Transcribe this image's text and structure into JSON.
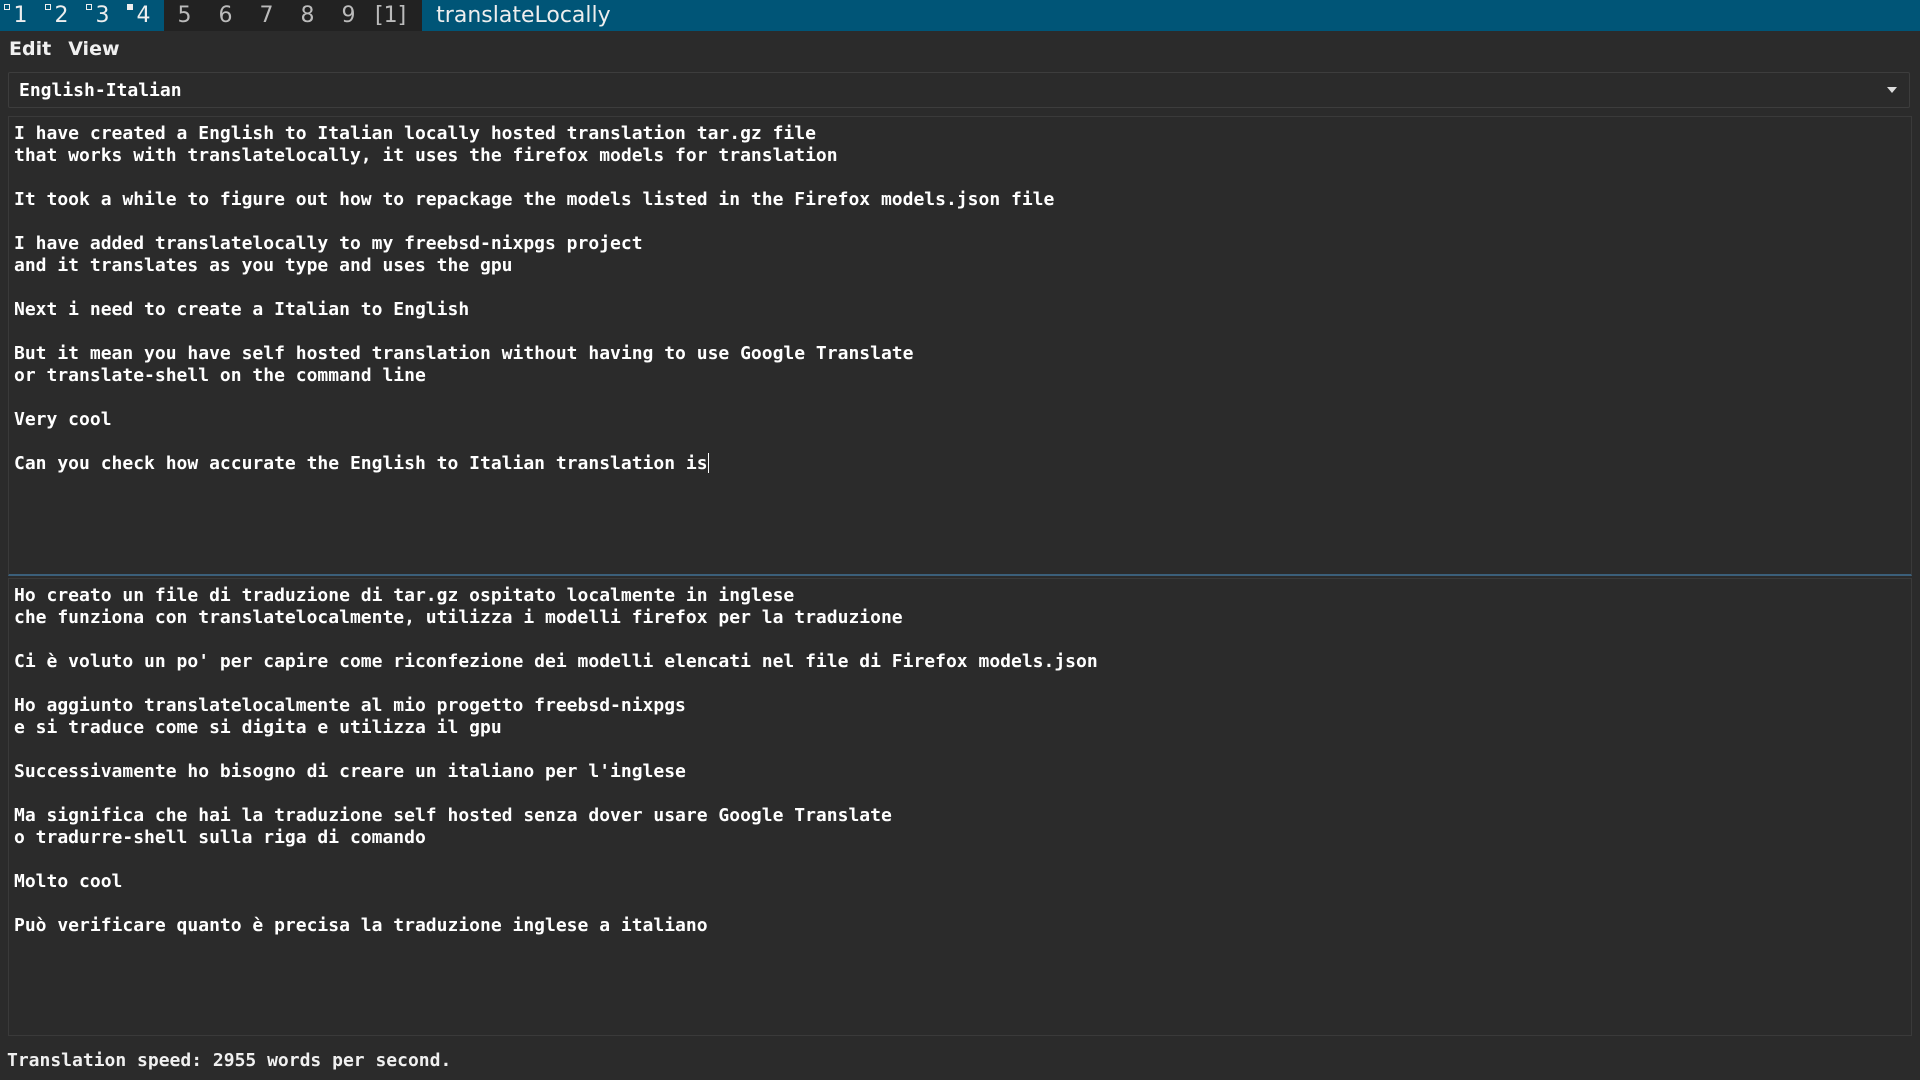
{
  "wm": {
    "workspaces": [
      {
        "label": "1",
        "state": "occupied"
      },
      {
        "label": "2",
        "state": "occupied"
      },
      {
        "label": "3",
        "state": "occupied"
      },
      {
        "label": "4",
        "state": "active"
      },
      {
        "label": "5",
        "state": "empty"
      },
      {
        "label": "6",
        "state": "empty"
      },
      {
        "label": "7",
        "state": "empty"
      },
      {
        "label": "8",
        "state": "empty"
      },
      {
        "label": "9",
        "state": "empty"
      }
    ],
    "layout": "[1]",
    "window_title": "translateLocally"
  },
  "menu": {
    "edit": "Edit",
    "view": "View"
  },
  "language_pair": "English-Italian",
  "source_text": "I have created a English to Italian locally hosted translation tar.gz file\nthat works with translatelocally, it uses the firefox models for translation\n\nIt took a while to figure out how to repackage the models listed in the Firefox models.json file\n\nI have added translatelocally to my freebsd-nixpgs project\nand it translates as you type and uses the gpu\n\nNext i need to create a Italian to English\n\nBut it mean you have self hosted translation without having to use Google Translate\nor translate-shell on the command line\n\nVery cool\n\nCan you check how accurate the English to Italian translation is",
  "translated_text": "Ho creato un file di traduzione di tar.gz ospitato localmente in inglese\nche funziona con translatelocalmente, utilizza i modelli firefox per la traduzione\n\nCi è voluto un po' per capire come riconfezione dei modelli elencati nel file di Firefox models.json\n\nHo aggiunto translatelocalmente al mio progetto freebsd-nixpgs\ne si traduce come si digita e utilizza il gpu\n\nSuccessivamente ho bisogno di creare un italiano per l'inglese\n\nMa significa che hai la traduzione self hosted senza dover usare Google Translate\no tradurre-shell sulla riga di comando\n\nMolto cool\n\nPuò verificare quanto è precisa la traduzione inglese a italiano",
  "status": "Translation speed: 2955 words per second.",
  "colors": {
    "bar": "#005577",
    "background": "#2b2b2b",
    "text": "#ffffff"
  }
}
